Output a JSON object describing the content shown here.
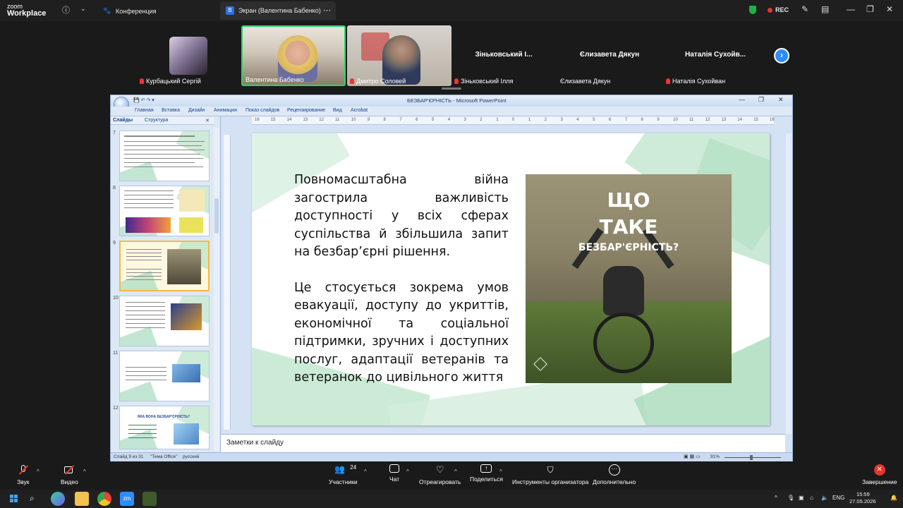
{
  "zoom": {
    "logo_top": "zoom",
    "logo_bottom": "Workplace",
    "tabs": {
      "conference": "Конференция",
      "screen": "Экран (Валентина Бабенко)"
    },
    "rec_label": "REC"
  },
  "gallery": {
    "participants": [
      {
        "name": "Курбацький Сергій",
        "muted": true
      },
      {
        "name": "Валентина Бабенко",
        "muted": false,
        "active": true
      },
      {
        "name": "Дмитро Соловей",
        "muted": true
      },
      {
        "name": "Зіньковський Ілля",
        "display": "Зіньковський І...",
        "muted": true
      },
      {
        "name": "Єлизавета Дякун",
        "display": "Єлизавета Дякун",
        "muted": false
      },
      {
        "name": "Наталія Сухойван",
        "display": "Наталія  Сухойв...",
        "muted": true
      }
    ]
  },
  "powerpoint": {
    "title": "БЕЗБАР'ЄРНІСТЬ - Microsoft PowerPoint",
    "ribbon_tabs": [
      "Главная",
      "Вставка",
      "Дизайн",
      "Анимация",
      "Показ слайдов",
      "Рецензирование",
      "Вид",
      "Acrobat"
    ],
    "pane_tabs": [
      "Слайды",
      "Структура"
    ],
    "thumbnails": [
      {
        "num": "7"
      },
      {
        "num": "8"
      },
      {
        "num": "9",
        "selected": true
      },
      {
        "num": "10"
      },
      {
        "num": "11"
      },
      {
        "num": "12",
        "title": "ЯКА ВОНА БЕЗБАР'ЄРНІСТЬ?"
      }
    ],
    "ruler_marks": [
      "16",
      "15",
      "14",
      "13",
      "12",
      "11",
      "10",
      "9",
      "8",
      "7",
      "6",
      "5",
      "4",
      "3",
      "2",
      "1",
      "0",
      "1",
      "2",
      "3",
      "4",
      "5",
      "6",
      "7",
      "8",
      "9",
      "10",
      "11",
      "12",
      "13",
      "14",
      "15",
      "16"
    ],
    "slide": {
      "paragraph1": "Повномасштабна війна загострила важливість доступності у всіх сферах суспільства й збільшила запит на безбар’єрні рішення.",
      "paragraph2": "Це стосується зокрема умов евакуації, доступу до укриттів, економічної та соціальної підтримки, зручних і доступних послуг, адаптації ветеранів та ветеранок до цивільного життя",
      "photo_title_1": "ЩО",
      "photo_title_2": "ТАКЕ",
      "photo_title_3": "БЕЗБАР'ЄРНІСТЬ?"
    },
    "notes_placeholder": "Заметки к слайду",
    "status": {
      "slide_info": "Слайд 9 из 31",
      "theme": "\"Тема Office\"",
      "language": "русский",
      "zoom": "91%"
    }
  },
  "toolbar": {
    "audio": "Звук",
    "video": "Видео",
    "participants": "Участники",
    "participants_count": "24",
    "chat": "Чат",
    "react": "Отреагировать",
    "share": "Поделиться",
    "host_tools": "Инструменты организатора",
    "more": "Дополнительно",
    "end": "Завершение"
  },
  "taskbar": {
    "lang": "ENG",
    "time": "15:59",
    "date": "27.05.2026"
  }
}
